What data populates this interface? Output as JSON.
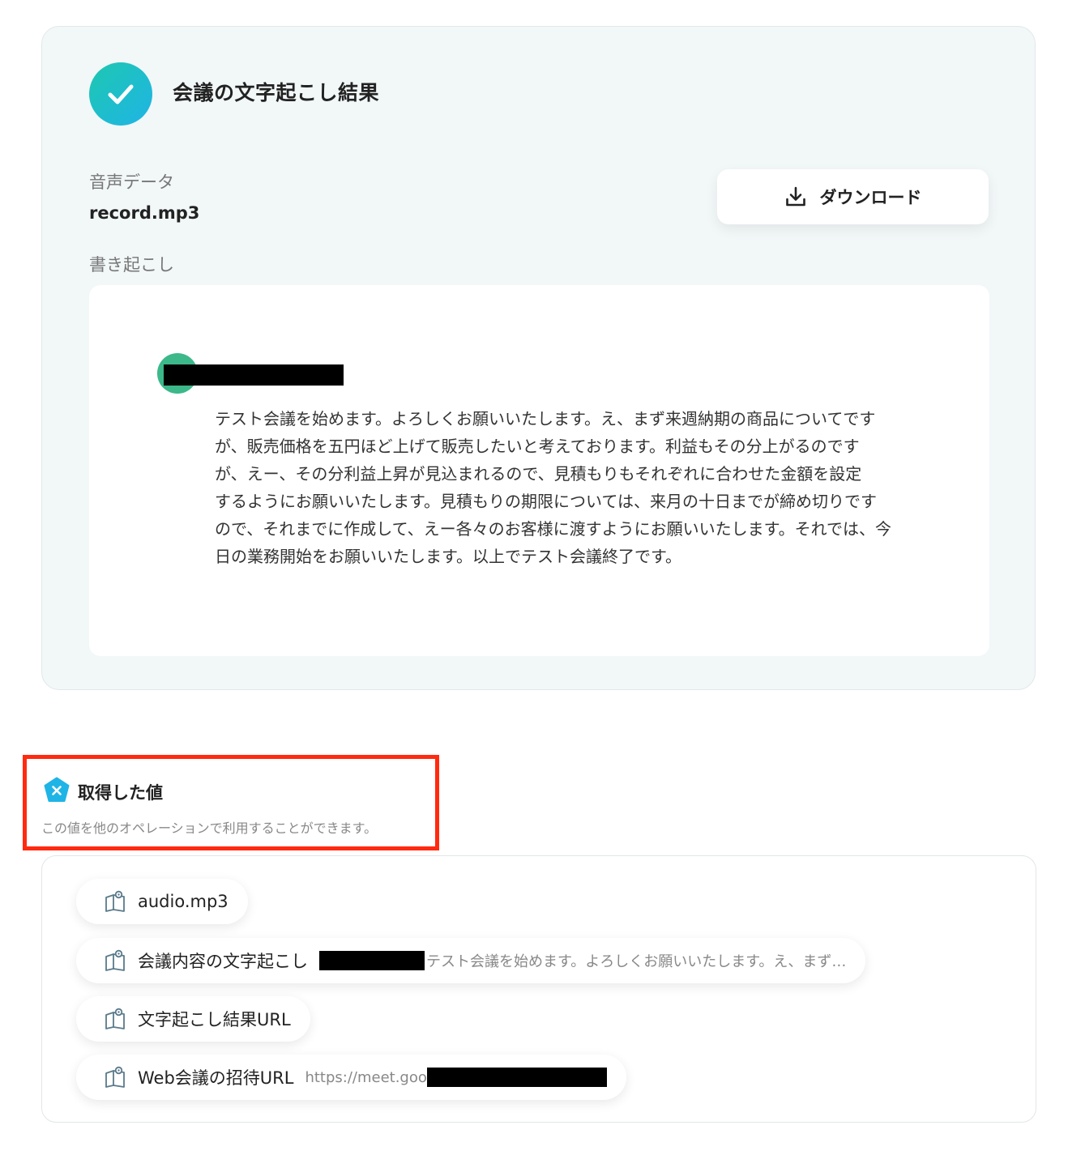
{
  "result": {
    "title": "会議の文字起こし結果",
    "audio_label": "音声データ",
    "audio_file": "record.mp3",
    "download_label": "ダウンロード",
    "transcript_label": "書き起こし",
    "speaker_name": "",
    "speech": "テスト会議を始めます。よろしくお願いいたします。え、まず来週納期の商品についてです\nが、販売価格を五円ほど上げて販売したいと考えております。利益もその分上がるのです\nが、えー、その分利益上昇が見込まれるので、見積もりもそれぞれに合わせた金額を設定\nするようにお願いいたします。見積もりの期限については、来月の十日までが締め切りです\nので、それまでに作成して、えー各々のお客様に渡すようにお願いいたします。それでは、今\n日の業務開始をお願いいたします。以上でテスト会議終了です。"
  },
  "values": {
    "title": "取得した値",
    "description": "この値を他のオペレーションで利用することができます。",
    "items": [
      {
        "label": "audio.mp3",
        "value": ""
      },
      {
        "label": "会議内容の文字起こし",
        "value": "テスト会議を始めます。よろしくお願いいたします。え、まず…"
      },
      {
        "label": "文字起こし結果URL",
        "value": ""
      },
      {
        "label": "Web会議の招待URL",
        "value": "https://meet.goo"
      }
    ]
  },
  "colors": {
    "accent_teal": "#1ec8b0",
    "accent_blue": "#1fb4e6",
    "highlight_red": "#ff2a10",
    "avatar_green": "#3cb88a"
  },
  "icons": {
    "check": "check-icon",
    "download": "download-icon",
    "variable": "x-badge-icon",
    "item": "book-tag-icon"
  }
}
